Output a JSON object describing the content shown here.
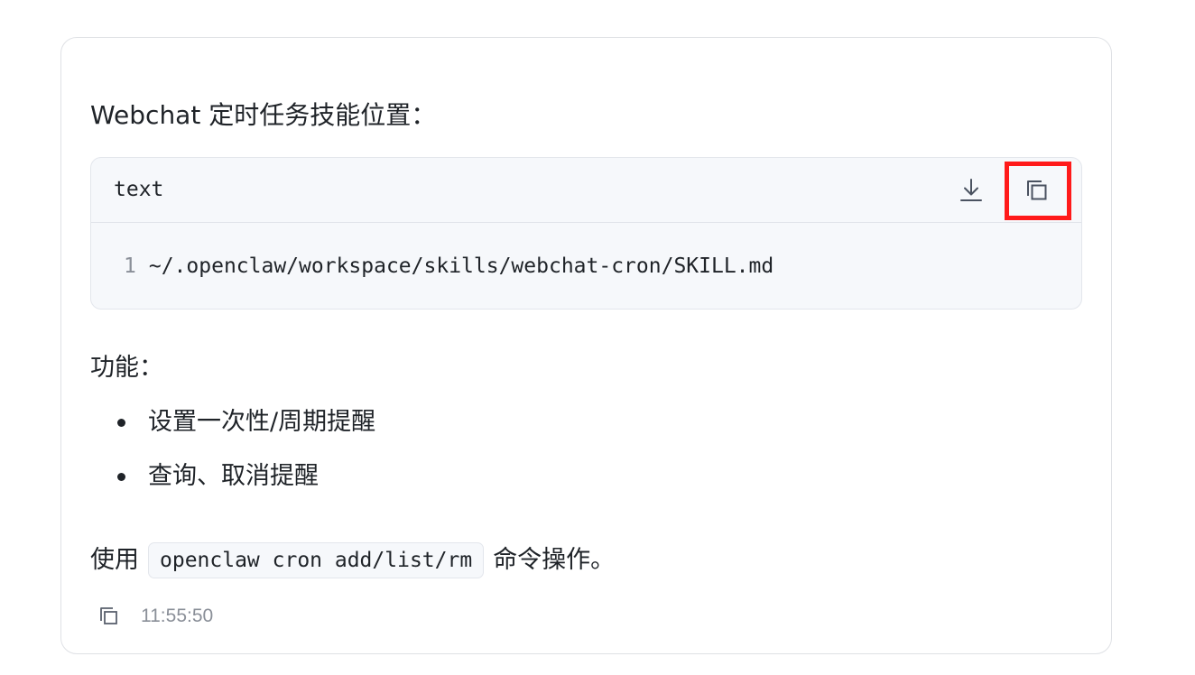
{
  "message": {
    "intro": "Webchat 定时任务技能位置：",
    "code_block": {
      "language": "text",
      "lines": [
        {
          "number": "1",
          "code": "~/.openclaw/workspace/skills/webchat-cron/SKILL.md"
        }
      ],
      "download_icon": "download-icon",
      "copy_icon": "copy-icon",
      "highlight_color": "#ff1a1a"
    },
    "features_label": "功能：",
    "features": [
      "设置一次性/周期提醒",
      "查询、取消提醒"
    ],
    "usage": {
      "prefix": "使用",
      "command": "openclaw cron add/list/rm",
      "suffix": "命令操作。"
    },
    "footer": {
      "copy_icon": "copy-icon",
      "timestamp": "11:55:50"
    }
  }
}
